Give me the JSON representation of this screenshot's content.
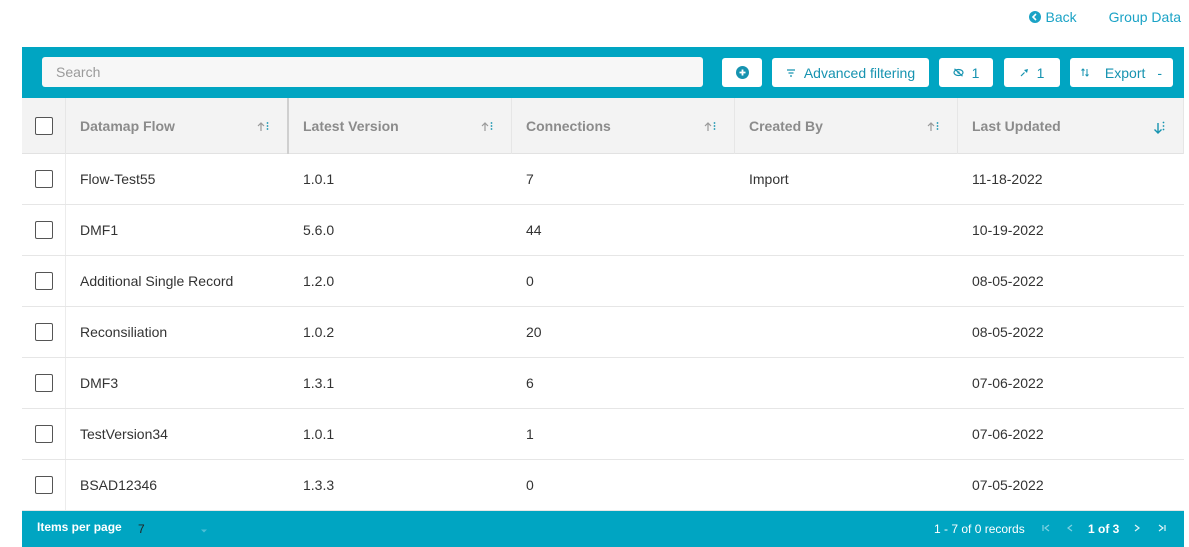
{
  "nav": {
    "back_label": "Back",
    "group_data_label": "Group Data"
  },
  "toolbar": {
    "search_placeholder": "Search",
    "advanced_filtering_label": "Advanced filtering",
    "hidden_count": "1",
    "pinned_count": "1",
    "export_label": "Export",
    "export_suffix": "-"
  },
  "table": {
    "columns": [
      "Datamap Flow",
      "Latest Version",
      "Connections",
      "Created By",
      "Last Updated"
    ],
    "rows": [
      {
        "flow": "Flow-Test55",
        "version": "1.0.1",
        "connections": "7",
        "created_by": "Import",
        "updated": "11-18-2022"
      },
      {
        "flow": "DMF1",
        "version": "5.6.0",
        "connections": "44",
        "created_by": "",
        "updated": "10-19-2022"
      },
      {
        "flow": "Additional Single Record",
        "version": "1.2.0",
        "connections": "0",
        "created_by": "",
        "updated": "08-05-2022"
      },
      {
        "flow": "Reconsiliation",
        "version": "1.0.2",
        "connections": "20",
        "created_by": "",
        "updated": "08-05-2022"
      },
      {
        "flow": "DMF3",
        "version": "1.3.1",
        "connections": "6",
        "created_by": "",
        "updated": "07-06-2022"
      },
      {
        "flow": "TestVersion34",
        "version": "1.0.1",
        "connections": "1",
        "created_by": "",
        "updated": "07-06-2022"
      },
      {
        "flow": "BSAD12346",
        "version": "1.3.3",
        "connections": "0",
        "created_by": "",
        "updated": "07-05-2022"
      }
    ]
  },
  "footer": {
    "items_per_page_label": "Items per page",
    "items_per_page_value": "7",
    "records_text": "1 - 7 of 0 records",
    "page_text": "1 of 3"
  },
  "colors": {
    "accent": "#00a5c2",
    "link": "#1ba3c6"
  },
  "icons": [
    "back-circle-icon",
    "plus-circle-icon",
    "filter-icon",
    "eye-slash-icon",
    "pin-icon",
    "export-icon",
    "sort-asc-icon",
    "sort-desc-icon",
    "kebab-icon",
    "chevron-down-icon",
    "first-page-icon",
    "prev-page-icon",
    "next-page-icon",
    "last-page-icon"
  ]
}
